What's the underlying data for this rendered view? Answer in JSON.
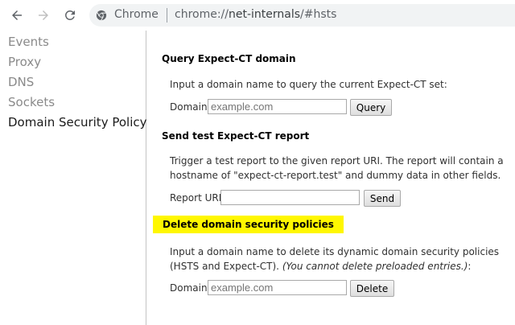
{
  "browser": {
    "omnibox_label": "Chrome",
    "url_prefix": "chrome://",
    "url_host": "net-internals",
    "url_suffix": "/#hsts"
  },
  "sidebar": {
    "items": [
      {
        "label": "Events"
      },
      {
        "label": "Proxy"
      },
      {
        "label": "DNS"
      },
      {
        "label": "Sockets"
      },
      {
        "label": "Domain Security Policy",
        "active": true
      }
    ]
  },
  "sections": {
    "query_ct": {
      "heading": "Query Expect-CT domain",
      "description": "Input a domain name to query the current Expect-CT set:",
      "field_label": "Domain:",
      "placeholder": "example.com",
      "button": "Query"
    },
    "send_report": {
      "heading": "Send test Expect-CT report",
      "description": "Trigger a test report to the given report URI. The report will contain a hostname of \"expect-ct-report.test\" and dummy data in other fields.",
      "field_label": "Report URI:",
      "button": "Send"
    },
    "delete_policies": {
      "heading": "Delete domain security policies",
      "description": "Input a domain name to delete its dynamic domain security policies (HSTS and Expect-CT). ",
      "description_note": "(You cannot delete preloaded entries.)",
      "description_end": ":",
      "field_label": "Domain:",
      "placeholder": "example.com",
      "button": "Delete",
      "highlight_color": "#fff700"
    }
  }
}
